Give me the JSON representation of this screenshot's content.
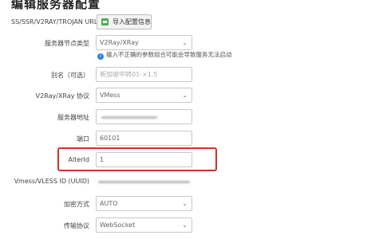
{
  "page": {
    "title": "编辑服务器配置"
  },
  "url_import": {
    "label": "SS/SSR/V2RAY/TROJAN URL",
    "button_label": "导入配置信息"
  },
  "server_type": {
    "label": "服务器节点类型",
    "value": "V2Ray/XRay",
    "hint": "输入不正确的参数组合可能会导致服务无法启动"
  },
  "alias": {
    "label": "别名（可选）",
    "placeholder": "新加坡中转01-×1.5"
  },
  "protocol": {
    "label": "V2Ray/XRay 协议",
    "value": "VMess"
  },
  "server_address": {
    "label": "服务器地址"
  },
  "port": {
    "label": "端口",
    "value": "60101"
  },
  "alter_id": {
    "label": "AlterId",
    "value": "1"
  },
  "uuid": {
    "label": "Vmess/VLESS ID (UUID)"
  },
  "encryption": {
    "label": "加密方式",
    "value": "AUTO"
  },
  "transport": {
    "label": "传输协议",
    "value": "WebSocket"
  },
  "colors": {
    "highlight": "#d32f2f",
    "info": "#2f80ed",
    "import_icon": "#4caf50"
  },
  "icons": {
    "import": "import-icon",
    "info": "info-icon",
    "dropdown": "chevron-down-icon"
  }
}
